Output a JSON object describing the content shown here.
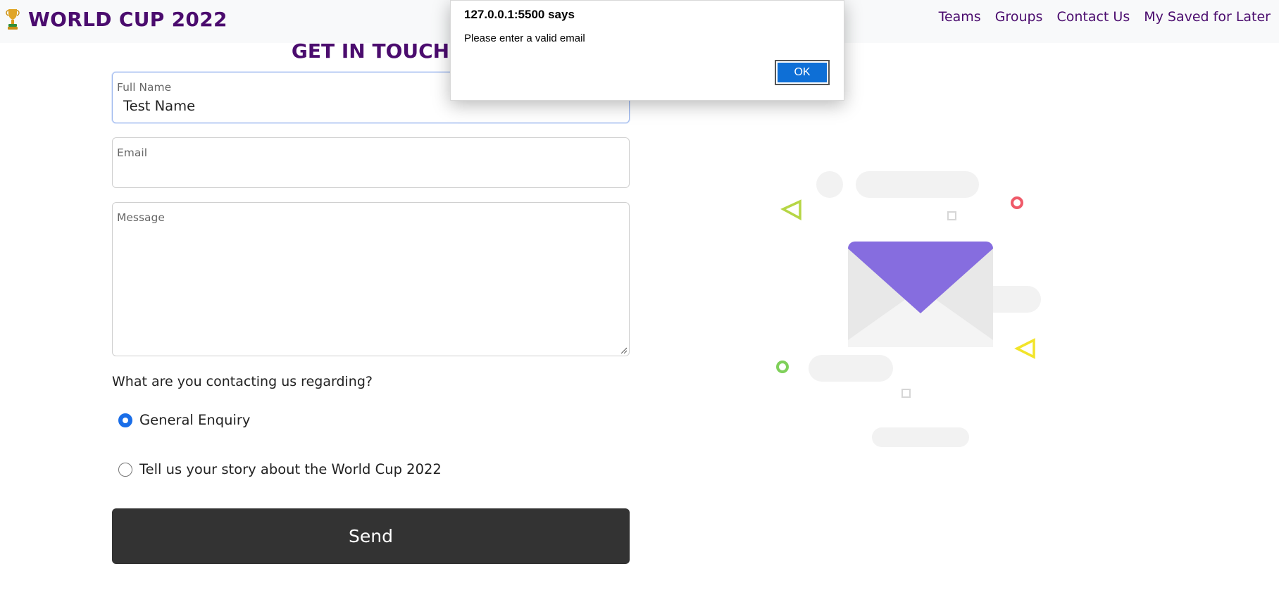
{
  "navbar": {
    "brand_icon": "trophy-icon",
    "brand_title": "WORLD CUP 2022",
    "links": [
      "Teams",
      "Groups",
      "Contact Us",
      "My Saved for Later"
    ]
  },
  "form": {
    "title": "GET IN TOUCH",
    "full_name": {
      "label": "Full Name",
      "value": "Test Name"
    },
    "email": {
      "label": "Email",
      "value": ""
    },
    "message": {
      "label": "Message",
      "value": ""
    },
    "question": "What are you contacting us regarding?",
    "options": [
      {
        "label": "General Enquiry",
        "checked": true
      },
      {
        "label": "Tell us your story about the World Cup 2022",
        "checked": false
      }
    ],
    "submit_label": "Send"
  },
  "illustration": {
    "icon": "envelope-icon",
    "accent_color": "#866ddf"
  },
  "dialog": {
    "title": "127.0.0.1:5500 says",
    "message": "Please enter a valid email",
    "ok_label": "OK"
  },
  "colors": {
    "brand": "#4b0c6e",
    "button_dark": "#333333",
    "radio_checked": "#1a6ee8",
    "dialog_ok": "#0e6fd6"
  }
}
